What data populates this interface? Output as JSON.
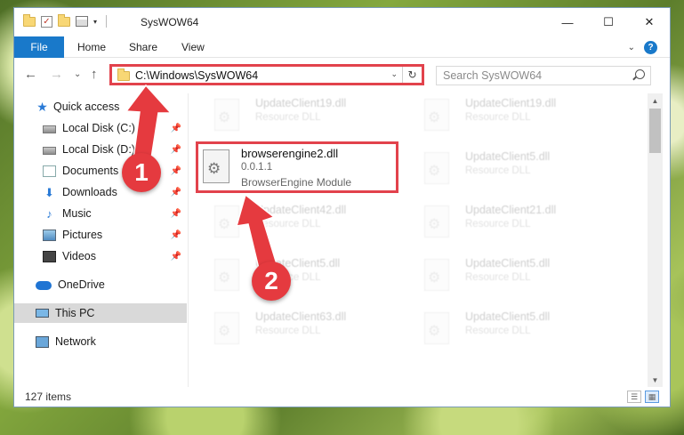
{
  "window": {
    "title": "SysWOW64",
    "controls": {
      "minimize": "—",
      "maximize": "☐",
      "close": "✕"
    }
  },
  "quick_access_toolbar": {
    "dropdown": "▾"
  },
  "ribbon": {
    "tabs": [
      {
        "label": "File",
        "active": true
      },
      {
        "label": "Home"
      },
      {
        "label": "Share"
      },
      {
        "label": "View"
      }
    ],
    "expand_chevron": "⌄",
    "help": "?"
  },
  "navigation": {
    "back": "←",
    "forward": "→",
    "recent": "⌄",
    "up": "↑",
    "address": "C:\\Windows\\SysWOW64",
    "address_dropdown": "⌄",
    "refresh": "↻",
    "search_placeholder": "Search SysWOW64"
  },
  "sidebar": {
    "items": [
      {
        "label": "Quick access",
        "icon": "star-icon",
        "pinned": false
      },
      {
        "label": "Local Disk (C:)",
        "icon": "disk-icon",
        "pinned": true
      },
      {
        "label": "Local Disk (D:)",
        "icon": "disk-icon",
        "pinned": true
      },
      {
        "label": "Documents",
        "icon": "documents-icon",
        "pinned": true
      },
      {
        "label": "Downloads",
        "icon": "downloads-icon",
        "pinned": true
      },
      {
        "label": "Music",
        "icon": "music-icon",
        "pinned": true
      },
      {
        "label": "Pictures",
        "icon": "pictures-icon",
        "pinned": true
      },
      {
        "label": "Videos",
        "icon": "videos-icon",
        "pinned": true
      },
      {
        "label": "OneDrive",
        "icon": "cloud-icon",
        "pinned": false
      },
      {
        "label": "This PC",
        "icon": "computer-icon",
        "pinned": false,
        "selected": true
      },
      {
        "label": "Network",
        "icon": "network-icon",
        "pinned": false
      }
    ],
    "pin_glyph": "📌"
  },
  "files": {
    "left_column": [
      {
        "name": "UpdateClient19.dll",
        "desc": "Resource DLL"
      },
      {
        "name": "UpdateClient42.dll",
        "desc": "Resource DLL"
      },
      {
        "name": "UpdateClient5.dll",
        "desc": "Resource DLL"
      },
      {
        "name": "UpdateClient63.dll",
        "desc": "Resource DLL"
      }
    ],
    "right_column": [
      {
        "name": "UpdateClient19.dll",
        "desc": "Resource DLL"
      },
      {
        "name": "UpdateClient5.dll",
        "desc": "Resource DLL"
      },
      {
        "name": "UpdateClient21.dll",
        "desc": "Resource DLL"
      },
      {
        "name": "UpdateClient5.dll",
        "desc": "Resource DLL"
      },
      {
        "name": "UpdateClient5.dll",
        "desc": "Resource DLL"
      }
    ],
    "highlighted": {
      "name": "browserengine2.dll",
      "version": "0.0.1.1",
      "desc": "BrowserEngine Module"
    }
  },
  "scrollbar": {
    "up": "▲",
    "down": "▼"
  },
  "status": {
    "count": "127 items",
    "view_details": "☰",
    "view_tiles": "▦"
  },
  "annotations": {
    "marker_1": "1",
    "marker_2": "2",
    "color": "#e53a3f"
  }
}
